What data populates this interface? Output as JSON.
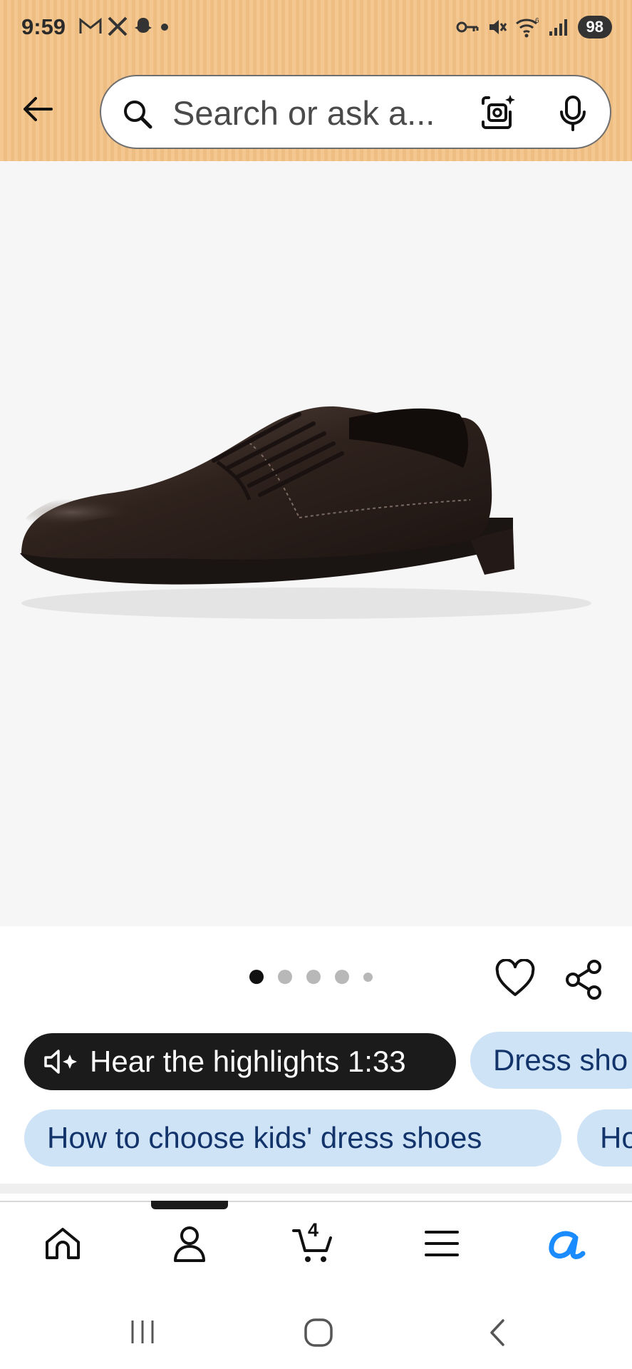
{
  "status_bar": {
    "time": "9:59",
    "left_icons": [
      "gmail-icon",
      "x-icon",
      "snapchat-icon",
      "dot-icon"
    ],
    "right_icons": [
      "key-icon",
      "mute-icon",
      "wifi-icon",
      "signal-icon"
    ],
    "wifi_label": "6",
    "battery": "98"
  },
  "header": {
    "back_icon": "arrow-left-icon",
    "search_placeholder": "Search or ask a...",
    "camera_icon": "camera-lens-icon",
    "mic_icon": "microphone-icon"
  },
  "product": {
    "image": "brown-leather-dress-shoe",
    "image_count": 5,
    "active_image": 1
  },
  "actions": {
    "favorite_icon": "heart-icon",
    "share_icon": "share-icon"
  },
  "chips": {
    "hear_highlights": "Hear the highlights 1:33",
    "row1_second": "Dress sho",
    "row2_first": "How to choose kids' dress shoes",
    "row2_second": "Ho"
  },
  "bottom_nav": {
    "items": [
      "home-icon",
      "account-icon",
      "cart-icon",
      "menu-icon",
      "rufus-icon"
    ],
    "cart_count": "4"
  },
  "system_nav": [
    "recents-icon",
    "home-circle-icon",
    "back-chevron-icon"
  ],
  "colors": {
    "header_bg": "#f3c78f",
    "chip_dark": "#1b1b1b",
    "chip_light": "#cfe3f7",
    "chip_text": "#12346b",
    "rufus_blue": "#1a8cff"
  }
}
